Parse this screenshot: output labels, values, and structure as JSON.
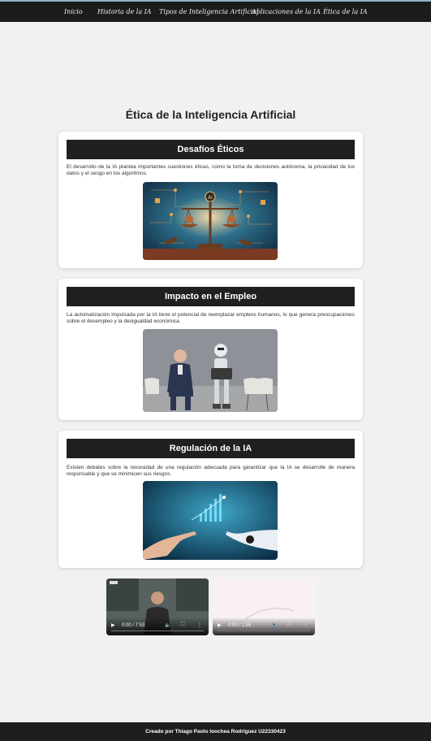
{
  "nav": {
    "items": [
      {
        "label": "Inicio"
      },
      {
        "label": "Historia de la IA"
      },
      {
        "label": "Tipos de Inteligencia Artificial"
      },
      {
        "label": "Aplicaciones de la IA"
      },
      {
        "label": "Ética de la IA"
      }
    ]
  },
  "page": {
    "title": "Ética de la Inteligencia Artificial"
  },
  "sections": [
    {
      "heading": "Desafíos Éticos",
      "text": "El desarrollo de la IA plantea importantes cuestiones éticas, como la toma de decisiones autónoma, la privacidad de los datos y el sesgo en los algoritmos."
    },
    {
      "heading": "Impacto en el Empleo",
      "text": "La automatización impulsada por la IA tiene el potencial de reemplazar empleos humanos, lo que genera preocupaciones sobre el desempleo y la desigualdad económica."
    },
    {
      "heading": "Regulación de la IA",
      "text": "Existen debates sobre la necesidad de una regulación adecuada para garantizar que la IA se desarrolle de manera responsable y que se minimicen sus riesgos."
    }
  ],
  "videos": [
    {
      "time": "0:00 / 7:53",
      "progress": 0
    },
    {
      "time": "0:00 / 1:55",
      "progress": 0
    }
  ],
  "footer": {
    "text": "Creado por Thiago Paolo Ioochea Rodriguez U22330423"
  }
}
